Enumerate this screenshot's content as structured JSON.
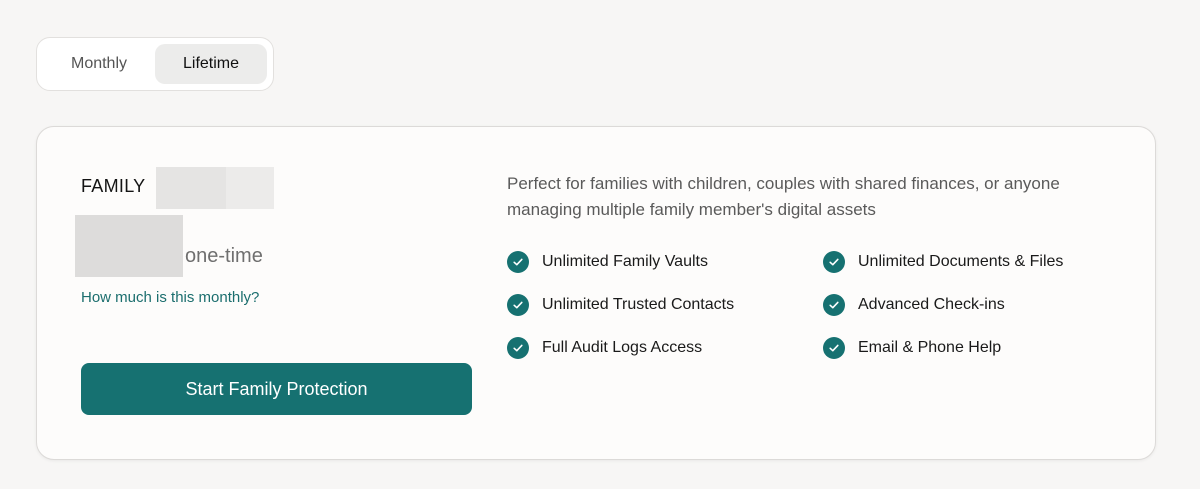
{
  "billing_toggle": {
    "options": [
      "Monthly",
      "Lifetime"
    ],
    "selected": "Lifetime"
  },
  "plan": {
    "name": "FAMILY",
    "price_suffix": "one-time",
    "monthly_link": "How much is this monthly?",
    "cta_label": "Start Family Protection",
    "description": "Perfect for families with children, couples with shared finances, or anyone managing multiple family member's digital assets",
    "features": [
      "Unlimited Family Vaults",
      "Unlimited Documents & Files",
      "Unlimited Trusted Contacts",
      "Advanced Check-ins",
      "Full Audit Logs Access",
      "Email & Phone Help"
    ]
  },
  "colors": {
    "accent": "#167171",
    "link": "#1b6e6e"
  },
  "icons": {
    "feature": "check-circle-icon"
  }
}
